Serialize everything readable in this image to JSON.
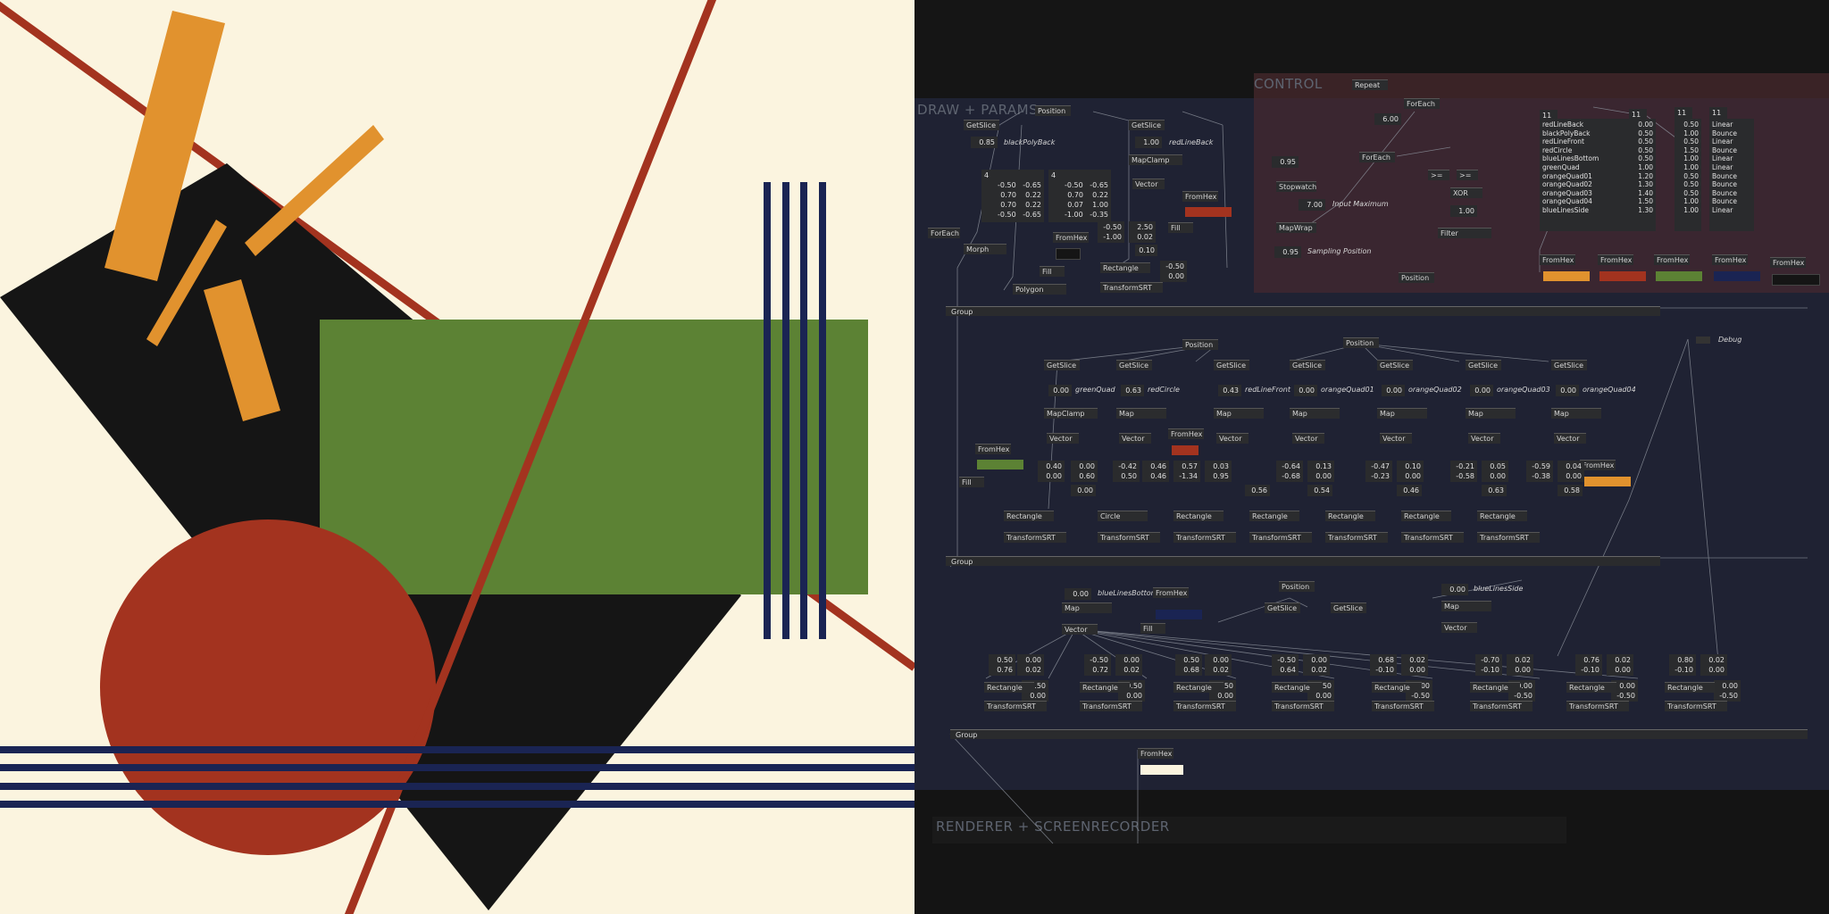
{
  "colors": {
    "cream": "#fbf4df",
    "black": "#151515",
    "orange": "#e1922e",
    "red": "#a3331f",
    "green": "#5c8234",
    "blue": "#1a2453",
    "patch_bg": "#1f2233",
    "control_bg": "#3a2326"
  },
  "regions": {
    "control": "CONTROL",
    "draw_params": "DRAW + PARAMS",
    "renderer": "RENDERER + SCREENRECORDER"
  },
  "control": {
    "repeat": "Repeat",
    "foreach_1": "ForEach",
    "foreach_2": "ForEach",
    "value_600": "6.00",
    "value_095a": "0.95",
    "stopwatch": "Stopwatch",
    "value_700": "7.00",
    "input_maximum": "Input Maximum",
    "mapwrap": "MapWrap",
    "value_095b": "0.95",
    "sampling_position": "Sampling Position",
    "gt_1": ">=",
    "gt_2": ">=",
    "xor": "XOR",
    "value_100": "1.00",
    "filter": "Filter",
    "position": "Position",
    "count_a": "11",
    "count_b": "11",
    "count_c": "11",
    "count_d": "11",
    "names": [
      "redLineBack",
      "blackPolyBack",
      "redLineFront",
      "redCircle",
      "blueLinesBottom",
      "greenQuad",
      "orangeQuad01",
      "orangeQuad02",
      "orangeQuad03",
      "orangeQuad04",
      "blueLinesSide"
    ],
    "col_a": [
      "0.00",
      "0.50",
      "0.50",
      "0.50",
      "0.50",
      "1.00",
      "1.20",
      "1.30",
      "1.40",
      "1.50",
      "1.30"
    ],
    "col_b": [
      "0.50",
      "1.00",
      "0.50",
      "1.50",
      "1.00",
      "1.00",
      "0.50",
      "0.50",
      "0.50",
      "1.00",
      "1.00"
    ],
    "easing": [
      "Linear",
      "Bounce",
      "Linear",
      "Bounce",
      "Linear",
      "Linear",
      "Bounce",
      "Bounce",
      "Bounce",
      "Bounce",
      "Linear"
    ],
    "fromhex": [
      "FromHex",
      "FromHex",
      "FromHex",
      "FromHex",
      "FromHex"
    ]
  },
  "draw": {
    "position_top": "Position",
    "getslice_1": "GetSlice",
    "getslice_2": "GetSlice",
    "val_085": "0.85",
    "label_blackpolyback": "blackPolyBack",
    "val_100": "1.00",
    "label_redlineback": "redLineBack",
    "mapclamp": "MapClamp",
    "vector": "Vector",
    "fromhex_1": "FromHex",
    "fromhex_2": "FromHex",
    "foreach": "ForEach",
    "morph": "Morph",
    "polygon": "Polygon",
    "fill_1": "Fill",
    "fill_2": "Fill",
    "rectangle": "Rectangle",
    "transformsrt": "TransformSRT",
    "count4a": "4",
    "count4b": "4",
    "polyA": "-0.50   -0.65\n 0.70    0.22\n 0.70    0.22\n-0.50   -0.65",
    "polyB": "-0.50   -0.65\n 0.70    0.22\n 0.07    1.00\n-1.00   -0.35",
    "v_size": "-0.50\n-1.00",
    "v_250": "2.50\n0.02",
    "v_010": "0.10",
    "v_050": "-0.50\n0.00",
    "group_1": "Group"
  },
  "mid": {
    "position_1": "Position",
    "position_2": "Position",
    "debug": "Debug",
    "getslice": [
      "GetSlice",
      "GetSlice",
      "GetSlice",
      "GetSlice",
      "GetSlice",
      "GetSlice",
      "GetSlice"
    ],
    "vals": [
      "0.00",
      "0.63",
      "0.43",
      "0.00",
      "0.00",
      "0.00",
      "0.00"
    ],
    "names": [
      "greenQuad",
      "redCircle",
      "redLineFront",
      "orangeQuad01",
      "orangeQuad02",
      "orangeQuad03",
      "orangeQuad04"
    ],
    "maps": [
      "MapClamp",
      "Map",
      "Map",
      "Map",
      "Map",
      "Map",
      "Map"
    ],
    "vectors": [
      "Vector",
      "Vector",
      "Vector",
      "Vector",
      "Vector",
      "Vector",
      "Vector"
    ],
    "fromhex_green": "FromHex",
    "fromhex_red": "FromHex",
    "fromhex_orange": "FromHex",
    "fill": "Fill",
    "pairs": [
      "0.40\n0.00",
      "0.00\n0.60",
      "-0.42\n0.50",
      "0.46\n0.46",
      "0.57\n-1.34",
      "0.03\n0.95",
      "-0.64\n-0.68",
      "0.13\n0.00",
      "-0.47\n-0.23",
      "0.10\n0.00",
      "-0.21\n-0.58",
      "0.05\n0.00",
      "-0.59\n-0.38",
      "0.04\n0.00"
    ],
    "singles": [
      "0.00",
      "0.56",
      "0.54",
      "0.46",
      "0.63",
      "0.58"
    ],
    "shapes": [
      "Rectangle",
      "Circle",
      "Rectangle",
      "Rectangle",
      "Rectangle",
      "Rectangle",
      "Rectangle"
    ],
    "srt": [
      "TransformSRT",
      "TransformSRT",
      "TransformSRT",
      "TransformSRT",
      "TransformSRT",
      "TransformSRT",
      "TransformSRT"
    ],
    "group": "Group"
  },
  "bottom": {
    "val_000a": "0.00",
    "label_bottom": "blueLinesBottom",
    "fromhex": "FromHex",
    "position": "Position",
    "getslice_a": "GetSlice",
    "getslice_b": "GetSlice",
    "val_000b": "0.00",
    "label_side": "blueLinesSide",
    "map_a": "Map",
    "map_b": "Map",
    "vector_a": "Vector",
    "vector_b": "Vector",
    "fill": "Fill",
    "pairs": [
      "0.50\n0.76",
      "0.00\n0.02",
      "-0.50\n0.72",
      "0.00\n0.02",
      "0.50\n0.68",
      "0.00\n0.02",
      "-0.50\n0.64",
      "0.00\n0.02",
      "0.68\n-0.10",
      "0.02\n0.00",
      "-0.70\n-0.10",
      "0.02\n0.00",
      "0.76\n-0.10",
      "0.02\n0.00",
      "0.80\n-0.10",
      "0.02\n0.00"
    ],
    "thirds": [
      "0.50\n0.00",
      "-0.50\n0.00",
      "0.50\n0.00",
      "-0.50\n0.00",
      "0.00\n-0.50",
      "0.00\n-0.50",
      "0.00\n-0.50",
      "0.00\n-0.50"
    ],
    "rect": [
      "Rectangle",
      "Rectangle",
      "Rectangle",
      "Rectangle",
      "Rectangle",
      "Rectangle",
      "Rectangle",
      "Rectangle"
    ],
    "srt": [
      "TransformSRT",
      "TransformSRT",
      "TransformSRT",
      "TransformSRT",
      "TransformSRT",
      "TransformSRT",
      "TransformSRT",
      "TransformSRT"
    ],
    "group": "Group",
    "fromhex_final": "FromHex"
  }
}
